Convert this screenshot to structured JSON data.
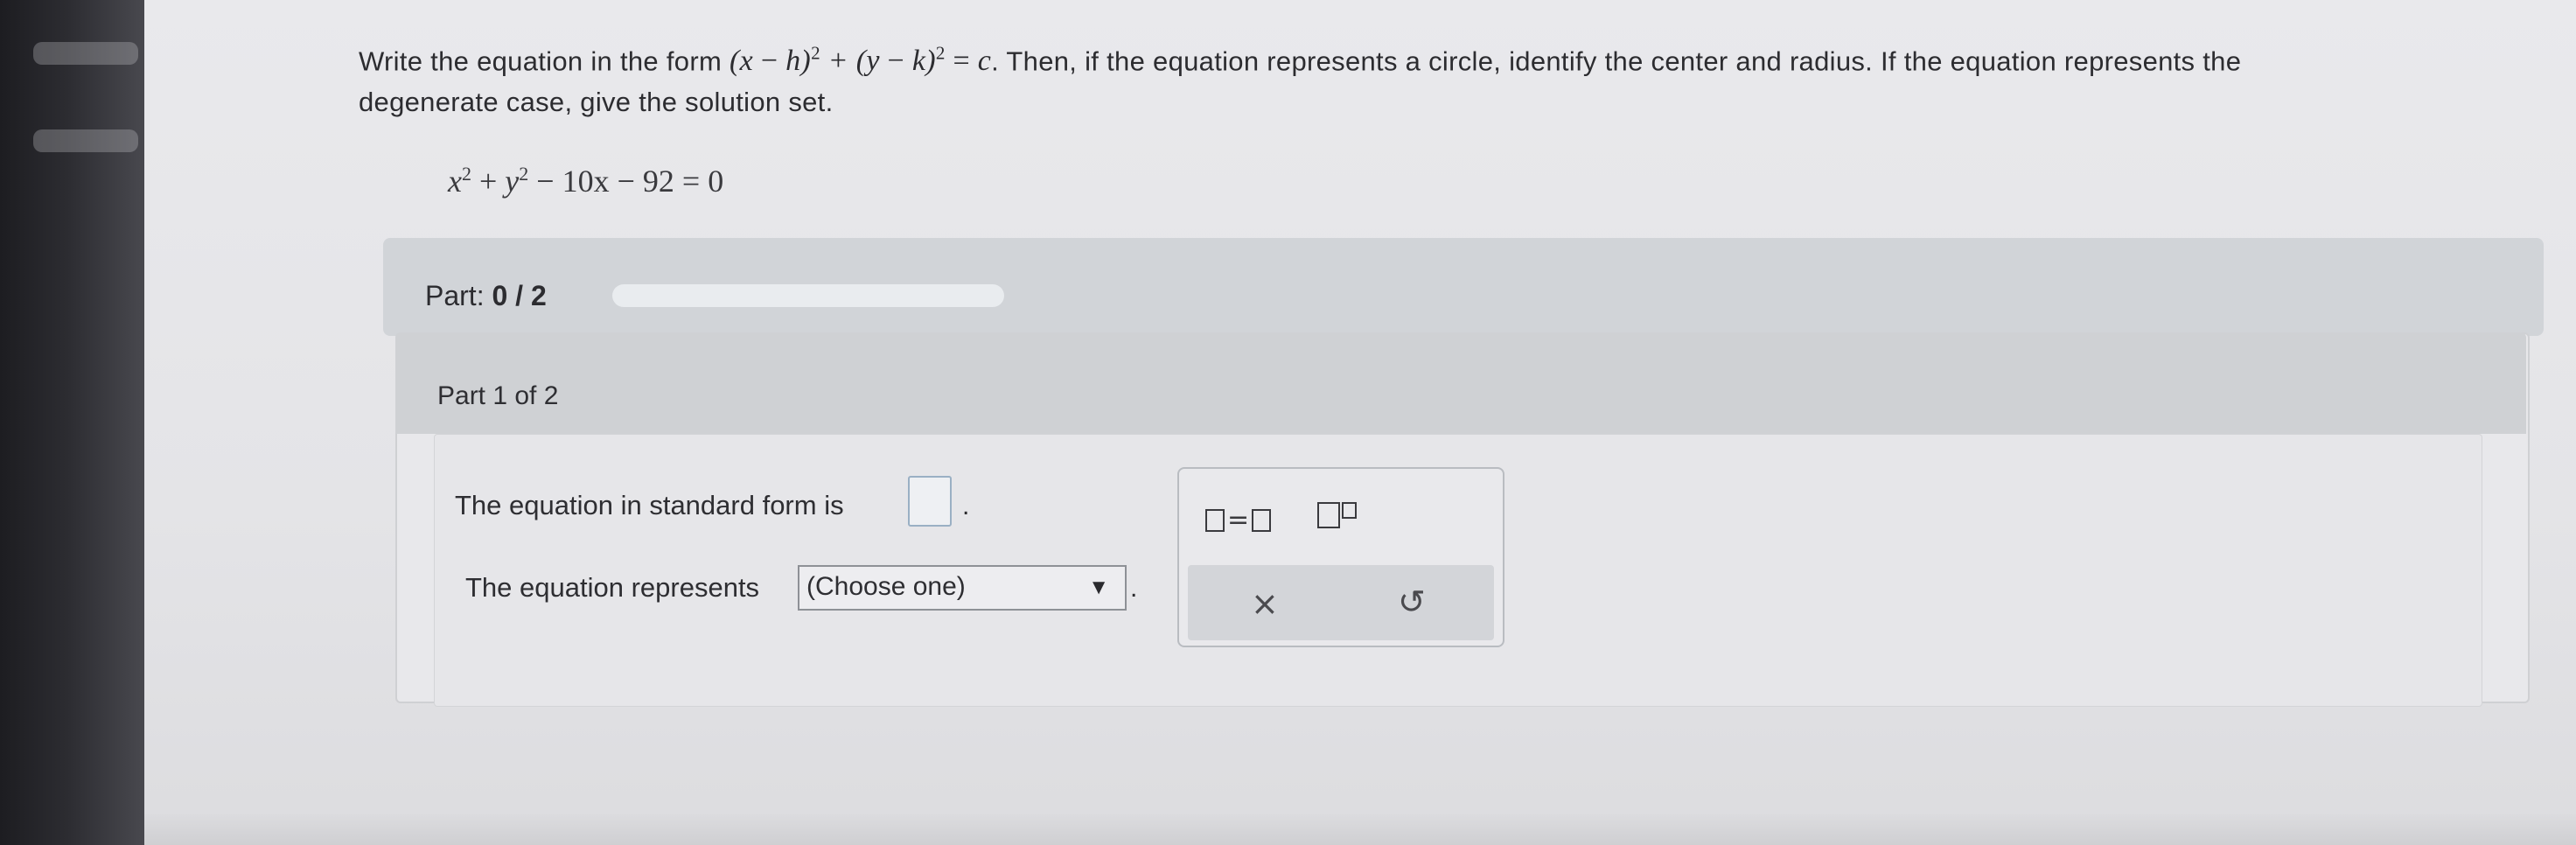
{
  "question": {
    "lead": "Write the equation in the form ",
    "form_math": "(x−h)²+(y−k)²=c",
    "rest_line1": ". Then, if the equation represents a circle, identify the center and radius. If the equation represents the",
    "rest_line2": "degenerate case, give the solution set."
  },
  "given_equation": {
    "term1": "x",
    "term2": "y",
    "exp": "2",
    "rest": " − 10x − 92 = 0"
  },
  "progress": {
    "prefix": "Part: ",
    "value": "0 / 2",
    "fraction": 0
  },
  "part": {
    "title": "Part 1 of 2"
  },
  "answer": {
    "standard_form_label": "The equation in standard form is",
    "standard_form_value": "",
    "represents_label": "The equation represents",
    "represents_selected": "(Choose one)",
    "period": "."
  },
  "toolbox": {
    "equals_symbol": "=",
    "clear_symbol": "×",
    "undo_symbol": "↺",
    "icons": [
      "equation-template-icon",
      "superscript-template-icon",
      "clear-icon",
      "undo-icon"
    ]
  }
}
